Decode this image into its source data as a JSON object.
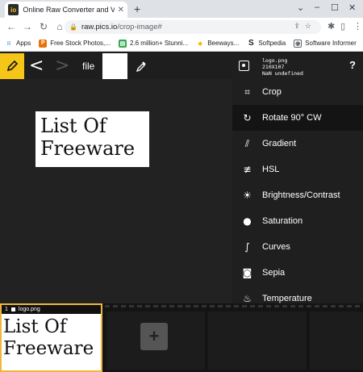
{
  "browser": {
    "tab_title": "Online Raw Converter and Viewer",
    "favicon_text": "io",
    "url_host": "raw.pics.io",
    "url_path": "/crop-image#",
    "bookmarks": [
      {
        "label": "Apps",
        "icon": "apps-grid-icon",
        "color": "#1a73e8"
      },
      {
        "label": "Free Stock Photos,...",
        "icon": "image-icon",
        "color": "#e8710a"
      },
      {
        "label": "2.6 million+ Stunni...",
        "icon": "photo-icon",
        "color": "#34a853"
      },
      {
        "label": "Beeways...",
        "icon": "bee-icon",
        "color": "#fbbc04"
      },
      {
        "label": "Softpedia",
        "icon": "softpedia-icon",
        "color": "#202124"
      },
      {
        "label": "Software Informer",
        "icon": "informer-icon",
        "color": "#5f6368"
      }
    ]
  },
  "app": {
    "file_button": "file",
    "accent_color": "#f5c518",
    "file_info": {
      "name": "logo.png",
      "dims": "210X107",
      "meta": "NaN undefined"
    },
    "help_label": "?",
    "tools": [
      {
        "label": "Crop",
        "icon": "crop-icon",
        "glyph": "⌗",
        "active": false
      },
      {
        "label": "Rotate 90° CW",
        "icon": "rotate-cw-icon",
        "glyph": "↻",
        "active": true
      },
      {
        "label": "Gradient",
        "icon": "gradient-icon",
        "glyph": "⫽",
        "active": false
      },
      {
        "label": "HSL",
        "icon": "hsl-sliders-icon",
        "glyph": "≢",
        "active": false
      },
      {
        "label": "Brightness/Contrast",
        "icon": "brightness-icon",
        "glyph": "☀",
        "active": false
      },
      {
        "label": "Saturation",
        "icon": "saturation-icon",
        "glyph": "●",
        "active": false
      },
      {
        "label": "Curves",
        "icon": "curves-icon",
        "glyph": "∫",
        "active": false
      },
      {
        "label": "Sepia",
        "icon": "sepia-icon",
        "glyph": "◙",
        "active": false
      },
      {
        "label": "Temperature",
        "icon": "temperature-icon",
        "glyph": "♨",
        "active": false
      }
    ],
    "image_text_line1": "List Of",
    "image_text_line2": "Freeware",
    "filmstrip": {
      "selected_index": "1",
      "selected_name": "logo.png",
      "thumb_line1": "List Of",
      "thumb_line2": "Freeware",
      "add_label": "+"
    }
  }
}
